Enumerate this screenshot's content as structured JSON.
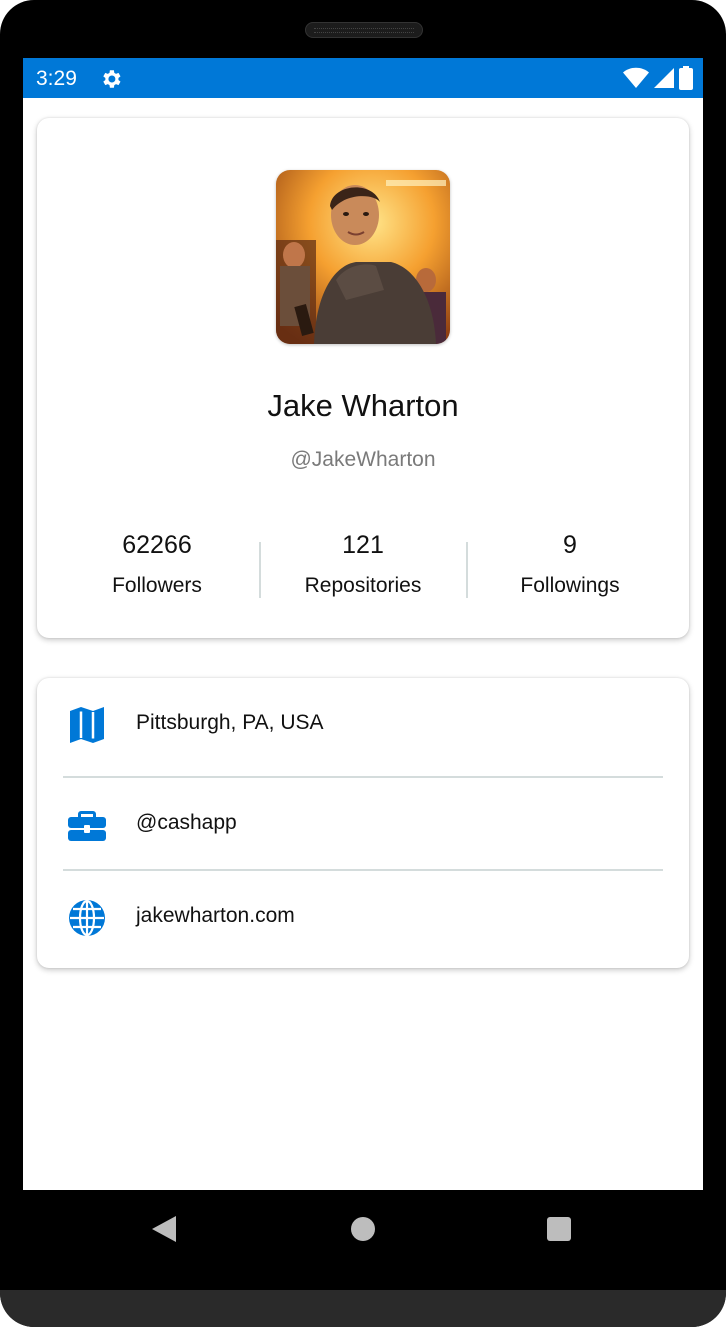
{
  "statusbar": {
    "time": "3:29",
    "icons": [
      "settings-icon",
      "wifi-icon",
      "cellular-signal-icon",
      "battery-icon"
    ],
    "color": "#0078d7"
  },
  "profile": {
    "name": "Jake Wharton",
    "handle": "@JakeWharton",
    "avatar": "profile-photo",
    "stats": [
      {
        "value": "62266",
        "label": "Followers"
      },
      {
        "value": "121",
        "label": "Repositories"
      },
      {
        "value": "9",
        "label": "Followings"
      }
    ]
  },
  "info": [
    {
      "icon": "map-icon",
      "text": "Pittsburgh, PA, USA"
    },
    {
      "icon": "briefcase-icon",
      "text": "@cashapp"
    },
    {
      "icon": "globe-icon",
      "text": "jakewharton.com"
    }
  ],
  "navbar": {
    "buttons": [
      "back-button",
      "home-button",
      "recent-apps-button"
    ]
  },
  "colors": {
    "accent": "#0078d7",
    "divider": "#d4dcdc",
    "secondary_text": "#7a7a7a"
  }
}
